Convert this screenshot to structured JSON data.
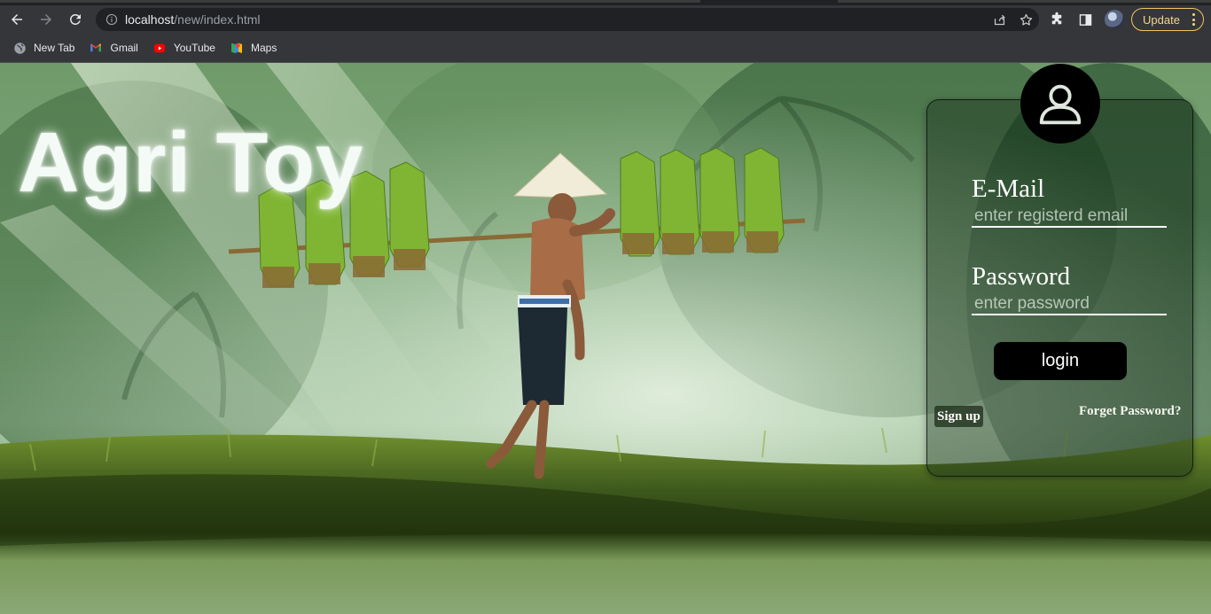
{
  "browser": {
    "url_host": "localhost",
    "url_path": "/new/index.html",
    "update_label": "Update",
    "bookmarks": [
      {
        "label": "New Tab",
        "icon": "globe-icon"
      },
      {
        "label": "Gmail",
        "icon": "gmail-icon"
      },
      {
        "label": "YouTube",
        "icon": "youtube-icon"
      },
      {
        "label": "Maps",
        "icon": "maps-icon"
      }
    ]
  },
  "page": {
    "brand": "Agri Toy",
    "background": "rice-farmer-carrying-seedlings-photo",
    "login": {
      "email_label": "E-Mail",
      "email_placeholder": "enter registerd email",
      "email_value": "",
      "password_label": "Password",
      "password_placeholder": "enter password",
      "password_value": "",
      "login_button": "login",
      "signup_link": "Sign up",
      "forgot_link": "Forget Password?",
      "avatar_icon": "user-icon"
    }
  },
  "colors": {
    "chrome_bg": "#35363a",
    "omnibox_bg": "#202124",
    "update_accent": "#f2c464",
    "card_border": "#0a140a",
    "button_bg": "#000000"
  }
}
